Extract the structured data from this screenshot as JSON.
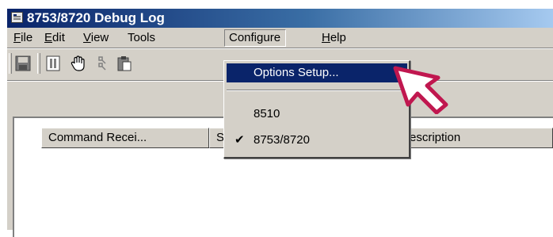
{
  "window": {
    "title": "8753/8720 Debug Log"
  },
  "menu": {
    "items": [
      {
        "label": "File",
        "underline": "F",
        "rest": "ile"
      },
      {
        "label": "Edit",
        "underline": "E",
        "rest": "dit"
      },
      {
        "label": "View",
        "underline": "V",
        "rest": "iew"
      },
      {
        "label": "Tools"
      },
      {
        "label": "Configure"
      },
      {
        "label": "Help",
        "underline": "H",
        "rest": "elp"
      }
    ]
  },
  "toolbar": {
    "buttons": [
      {
        "icon": "save-icon"
      },
      {
        "icon": "pause-icon"
      },
      {
        "icon": "hand-icon"
      },
      {
        "icon": "filter-icon"
      },
      {
        "icon": "clipboard-icon"
      }
    ]
  },
  "configure_menu": {
    "items": [
      {
        "label": "Options Setup...",
        "selected": true
      },
      {
        "label": "8510",
        "checked": false
      },
      {
        "label": "8753/8720",
        "checked": true
      }
    ],
    "check_glyph": "✔"
  },
  "log": {
    "columns": [
      "Command Recei...",
      "St",
      "escription"
    ]
  },
  "colors": {
    "title_dark": "#0a246a",
    "title_light": "#a6caf0",
    "pointer": "#c0174f",
    "face": "#d4d0c8"
  }
}
